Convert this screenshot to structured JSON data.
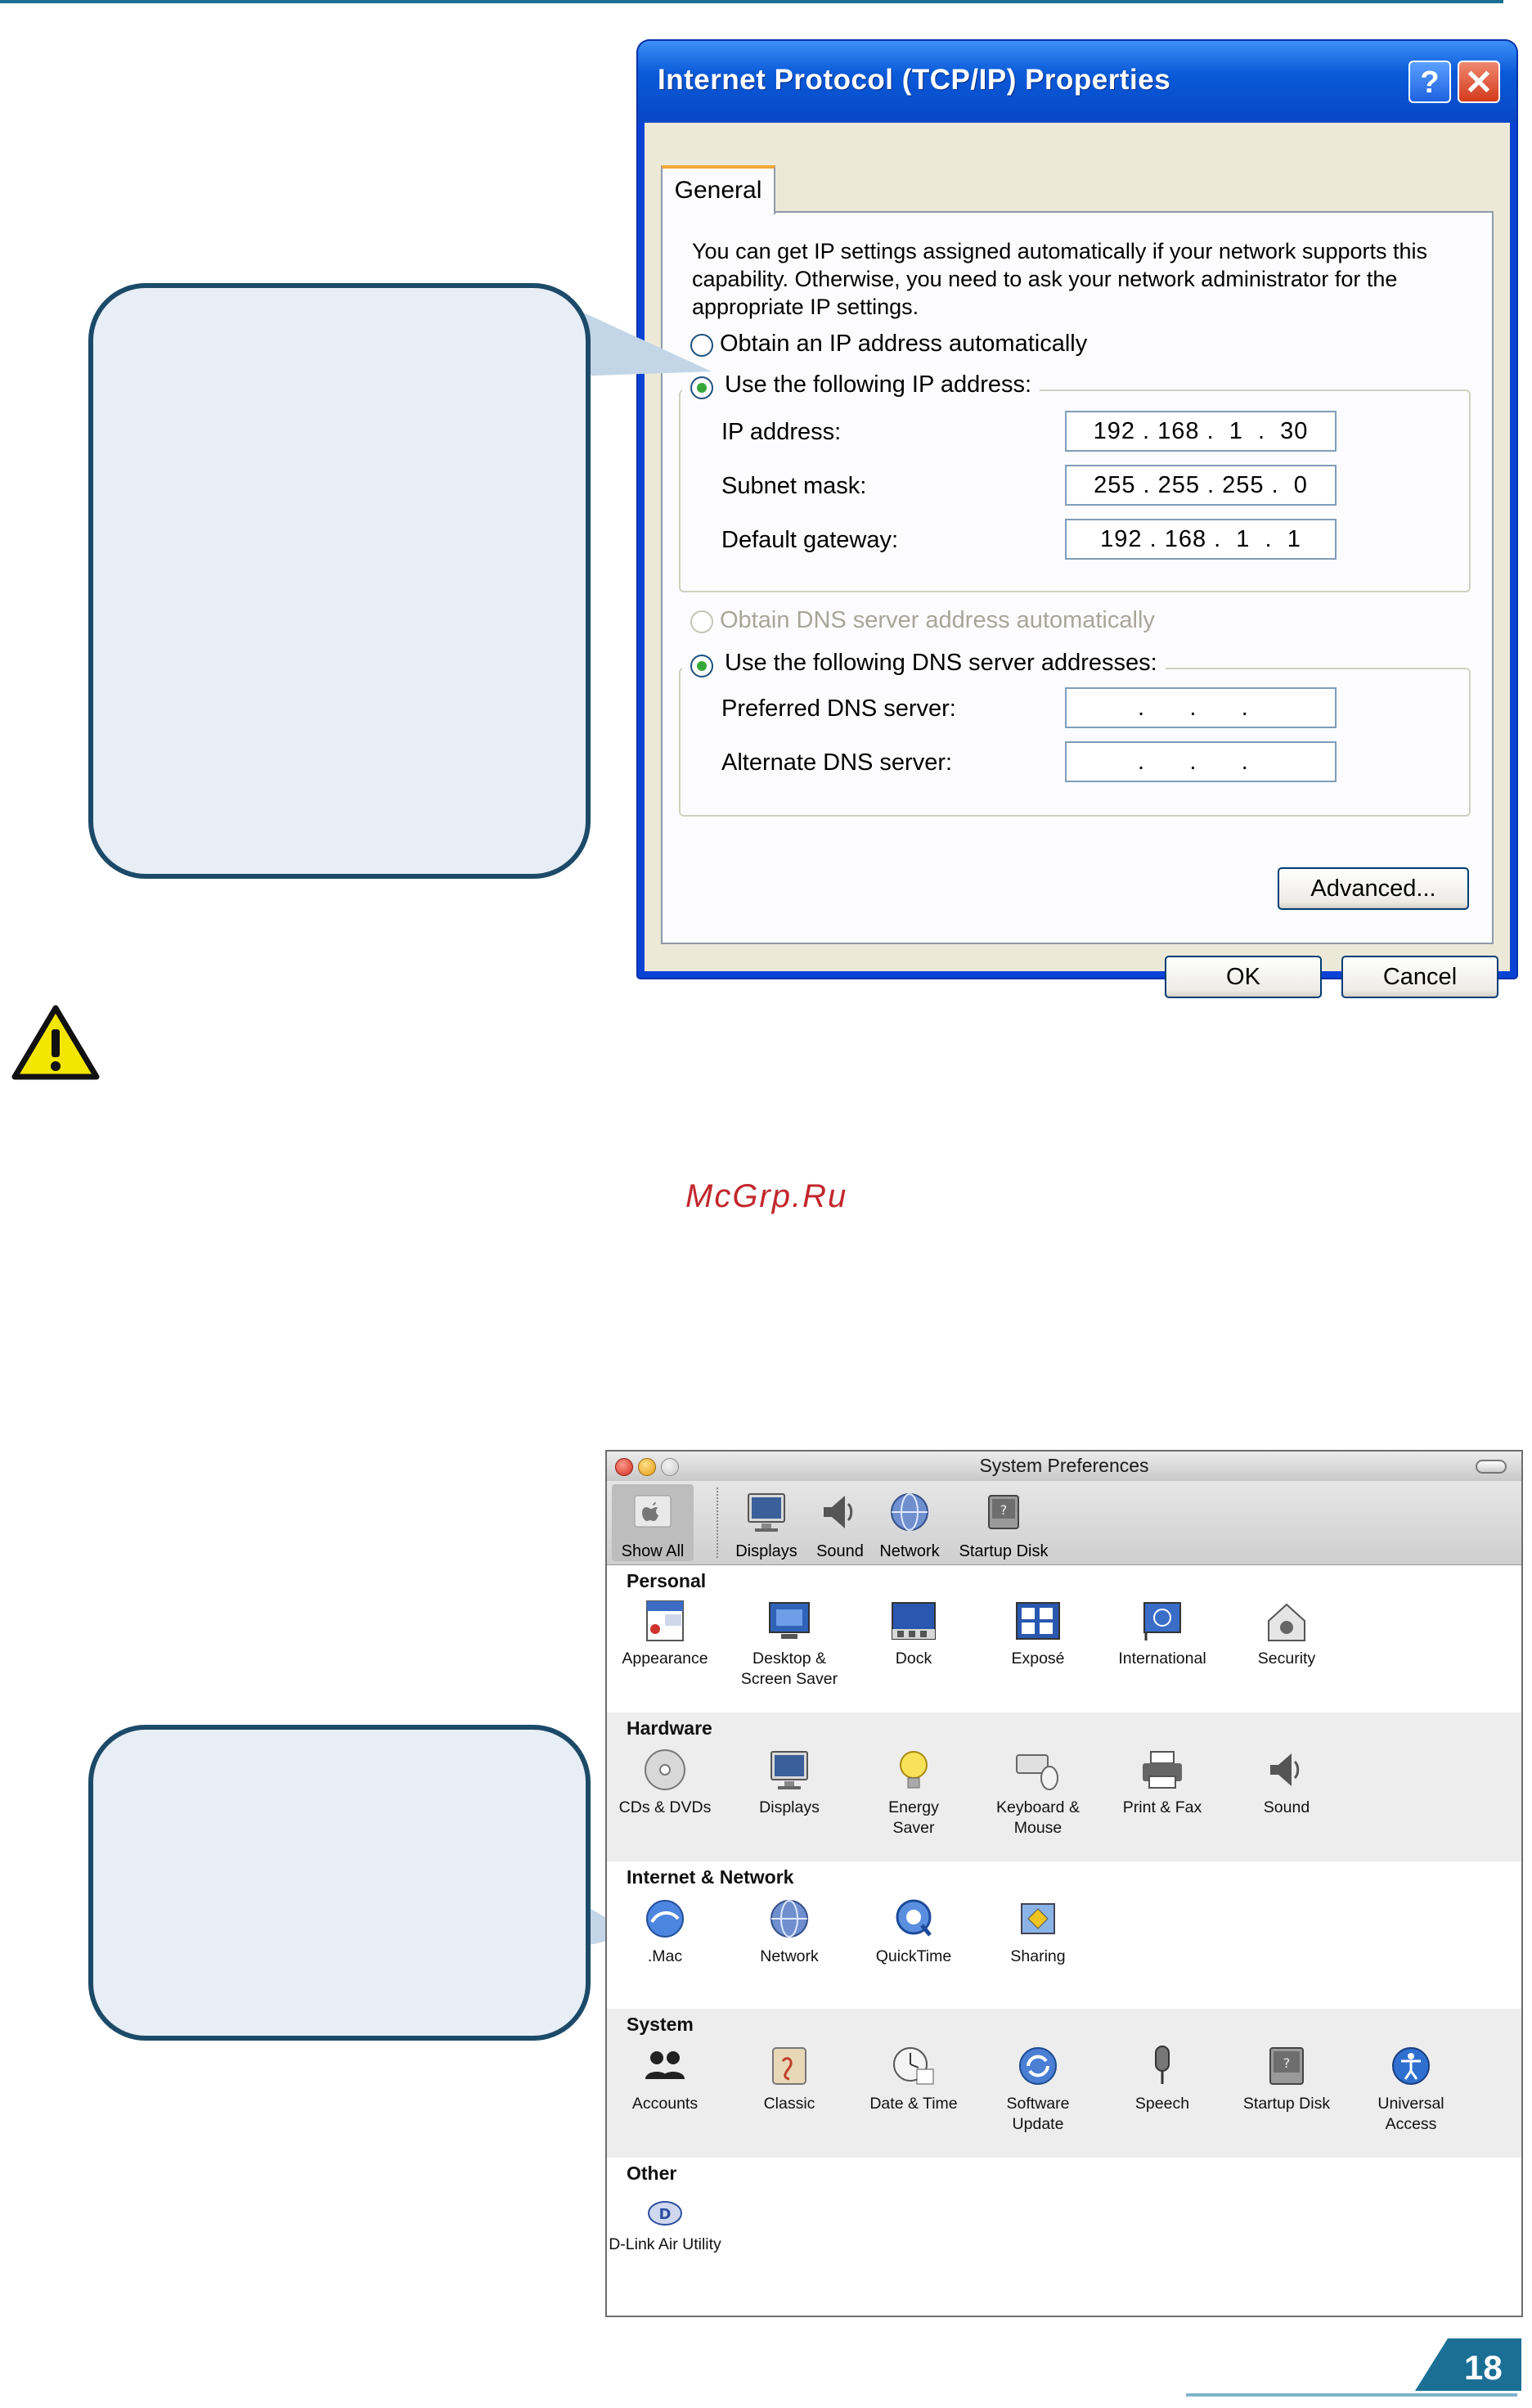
{
  "xp_dialog": {
    "title": "Internet Protocol (TCP/IP) Properties",
    "help_button": "?",
    "close_button": "✕",
    "tab": "General",
    "intro": "You can get IP settings assigned automatically if your network supports this capability. Otherwise, you need to ask your network administrator for the appropriate IP settings.",
    "radio_auto_ip": "Obtain an IP address automatically",
    "radio_manual_ip": "Use the following IP address:",
    "ip_label": "IP address:",
    "ip_value": "192 . 168 .  1  .  30",
    "subnet_label": "Subnet mask:",
    "subnet_value": "255 . 255 . 255 .  0",
    "gateway_label": "Default gateway:",
    "gateway_value": "192 . 168 .  1  .  1",
    "radio_auto_dns": "Obtain DNS server address automatically",
    "radio_manual_dns": "Use the following DNS server addresses:",
    "preferred_dns_label": "Preferred DNS server:",
    "preferred_dns_value": " .      .      .   ",
    "alternate_dns_label": "Alternate DNS server:",
    "alternate_dns_value": " .      .      .   ",
    "advanced_button": "Advanced...",
    "ok_button": "OK",
    "cancel_button": "Cancel"
  },
  "watermark": "McGrp.Ru",
  "mac_window": {
    "title": "System Preferences",
    "toolbar": [
      {
        "label": "Show All",
        "icon": "apple-icon"
      },
      {
        "label": "Displays",
        "icon": "display-icon"
      },
      {
        "label": "Sound",
        "icon": "speaker-icon"
      },
      {
        "label": "Network",
        "icon": "globe-icon"
      },
      {
        "label": "Startup Disk",
        "icon": "disk-icon"
      }
    ],
    "sections": [
      {
        "title": "Personal",
        "items": [
          {
            "lines": [
              "Appearance"
            ],
            "icon": "appearance-icon"
          },
          {
            "lines": [
              "Desktop &",
              "Screen Saver"
            ],
            "icon": "desktop-icon"
          },
          {
            "lines": [
              "Dock"
            ],
            "icon": "dock-icon"
          },
          {
            "lines": [
              "Exposé"
            ],
            "icon": "expose-icon"
          },
          {
            "lines": [
              "International"
            ],
            "icon": "flag-icon"
          },
          {
            "lines": [
              "Security"
            ],
            "icon": "house-icon"
          }
        ]
      },
      {
        "title": "Hardware",
        "items": [
          {
            "lines": [
              "CDs & DVDs"
            ],
            "icon": "cd-icon"
          },
          {
            "lines": [
              "Displays"
            ],
            "icon": "display-icon"
          },
          {
            "lines": [
              "Energy",
              "Saver"
            ],
            "icon": "bulb-icon"
          },
          {
            "lines": [
              "Keyboard &",
              "Mouse"
            ],
            "icon": "keyboard-icon"
          },
          {
            "lines": [
              "Print & Fax"
            ],
            "icon": "printer-icon"
          },
          {
            "lines": [
              "Sound"
            ],
            "icon": "speaker-icon"
          }
        ]
      },
      {
        "title": "Internet & Network",
        "items": [
          {
            "lines": [
              ".Mac"
            ],
            "icon": "dotmac-icon"
          },
          {
            "lines": [
              "Network"
            ],
            "icon": "globe-icon"
          },
          {
            "lines": [
              "QuickTime"
            ],
            "icon": "quicktime-icon"
          },
          {
            "lines": [
              "Sharing"
            ],
            "icon": "sharing-icon"
          }
        ]
      },
      {
        "title": "System",
        "items": [
          {
            "lines": [
              "Accounts"
            ],
            "icon": "people-icon"
          },
          {
            "lines": [
              "Classic"
            ],
            "icon": "classic-icon"
          },
          {
            "lines": [
              "Date & Time"
            ],
            "icon": "clock-icon"
          },
          {
            "lines": [
              "Software",
              "Update"
            ],
            "icon": "update-icon"
          },
          {
            "lines": [
              "Speech"
            ],
            "icon": "microphone-icon"
          },
          {
            "lines": [
              "Startup Disk"
            ],
            "icon": "disk-icon"
          },
          {
            "lines": [
              "Universal",
              "Access"
            ],
            "icon": "accessibility-icon"
          }
        ]
      },
      {
        "title": "Other",
        "items": [
          {
            "lines": [
              "D-Link Air Utility"
            ],
            "icon": "dlink-icon"
          }
        ]
      }
    ]
  },
  "page_number": "18",
  "colors": {
    "accent": "#1b6f95",
    "callout_fill": "#e8eef6",
    "callout_border": "#1c4a68"
  }
}
